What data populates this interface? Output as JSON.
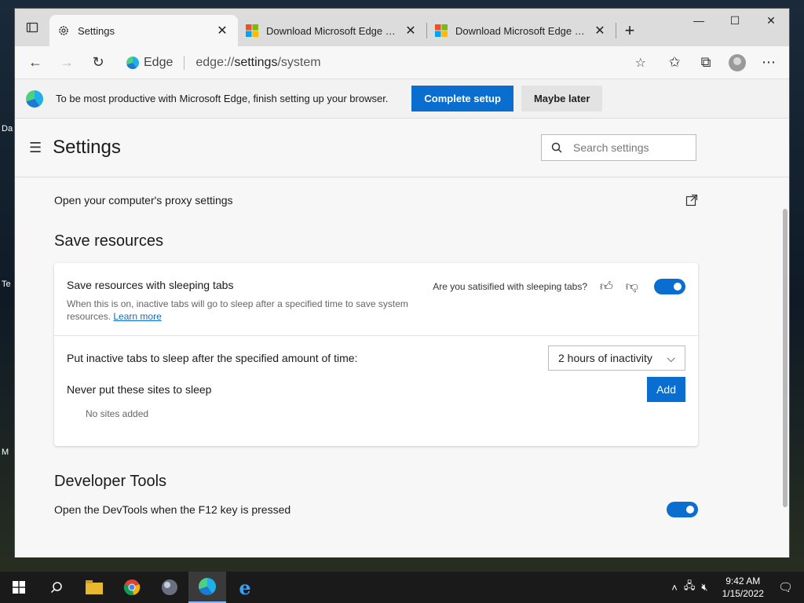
{
  "desktop": {
    "frag1": "Da",
    "frag2": "Te",
    "frag3": "M"
  },
  "tabs": [
    {
      "title": "Settings",
      "icon": "gear-icon"
    },
    {
      "title": "Download Microsoft Edge Web Browser",
      "icon": "microsoft-logo-icon"
    },
    {
      "title": "Download Microsoft Edge Web Browser",
      "icon": "microsoft-logo-icon"
    }
  ],
  "address": {
    "site": "Edge",
    "url_prefix": "edge://",
    "url_bold": "settings",
    "url_suffix": "/system"
  },
  "infobar": {
    "message": "To be most productive with Microsoft Edge, finish setting up your browser.",
    "primary": "Complete setup",
    "secondary": "Maybe later"
  },
  "settings": {
    "title": "Settings",
    "search_placeholder": "Search settings",
    "proxy_label": "Open your computer's proxy settings",
    "save_resources": {
      "title": "Save resources",
      "sleeping_tabs": "Save resources with sleeping tabs",
      "sleeping_desc": "When this is on, inactive tabs will go to sleep after a specified time to save system resources.",
      "learn_more": "Learn more",
      "feedback_q": "Are you satisified with sleeping tabs?",
      "sleeping_on": true,
      "inactive_label": "Put inactive tabs to sleep after the specified amount of time:",
      "inactive_value": "2 hours of inactivity",
      "never_label": "Never put these sites to sleep",
      "add": "Add",
      "no_sites": "No sites added"
    },
    "devtools": {
      "title": "Developer Tools",
      "f12_label": "Open the DevTools when the F12 key is pressed",
      "f12_on": true
    }
  },
  "taskbar": {
    "time": "9:42 AM",
    "date": "1/15/2022"
  },
  "colors": {
    "accent": "#0a6ed1"
  }
}
